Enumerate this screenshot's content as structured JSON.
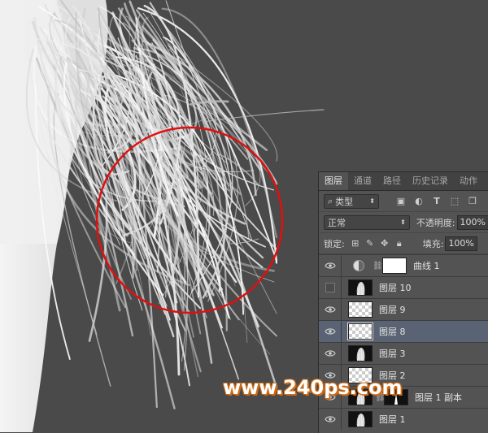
{
  "watermark": {
    "text": "www.240ps.com"
  },
  "panel": {
    "tabs": [
      "图层",
      "通道",
      "路径",
      "历史记录",
      "动作"
    ],
    "filter": {
      "icon": "search-icon",
      "label": "类型"
    },
    "blend_mode": "正常",
    "opacity_label": "不透明度:",
    "opacity_value": "100%",
    "lock_label": "锁定:",
    "fill_label": "填充:",
    "fill_value": "100%",
    "layers": [
      {
        "name": "曲线 1",
        "visible": true,
        "thumb": "adjustment-white"
      },
      {
        "name": "图层 10",
        "visible": false,
        "thumb": "dark-hair"
      },
      {
        "name": "图层 9",
        "visible": true,
        "thumb": "transparent"
      },
      {
        "name": "图层 8",
        "visible": true,
        "thumb": "transparent",
        "selected": true
      },
      {
        "name": "图层 3",
        "visible": true,
        "thumb": "dark-hair"
      },
      {
        "name": "图层 2",
        "visible": true,
        "thumb": "transparent"
      },
      {
        "name": "图层 1 副本",
        "visible": true,
        "thumb": "dark-hair-mask"
      },
      {
        "name": "图层 1",
        "visible": true,
        "thumb": "dark-hair"
      }
    ]
  },
  "colors": {
    "canvas_bg": "#4a4a4a",
    "circle": "#e01010",
    "watermark_outline": "#d06a14",
    "selected_row": "#5a6373"
  }
}
